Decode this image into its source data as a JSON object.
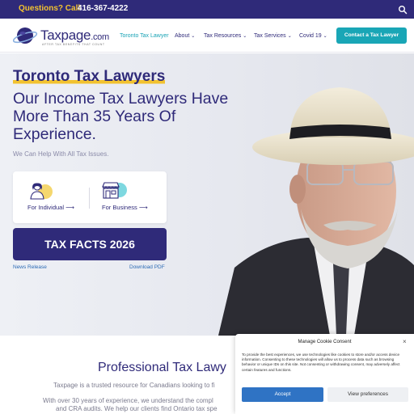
{
  "topbar": {
    "question": "Questions? Call",
    "phone": "416-367-4222"
  },
  "logo": {
    "word": "Taxpage",
    "domain": ".com",
    "tagline": "AFTER TAX BENEFITS THAT COUNT"
  },
  "nav": {
    "items": [
      {
        "label": "Toronto Tax Lawyer",
        "dropdown": false,
        "active": true
      },
      {
        "label": "About",
        "dropdown": true
      },
      {
        "label": "Tax Resources",
        "dropdown": true
      },
      {
        "label": "Tax Services",
        "dropdown": true
      },
      {
        "label": "Covid 19",
        "dropdown": true
      }
    ],
    "chevron": "⌄",
    "cta": "Contact a Tax Lawyer"
  },
  "hero": {
    "title": "Toronto Tax Lawyers",
    "subtitle": "Our Income Tax Lawyers Have More Than 35 Years Of Experience.",
    "help": "We Can Help With All Tax Issues.",
    "individual": "For Individual ⟶",
    "business": "For Business ⟶",
    "tax_facts": "TAX FACTS 2026",
    "news": "News Release",
    "download": "Download PDF"
  },
  "content": {
    "title": "Professional Tax Lawy",
    "para1": "Taxpage is a trusted resource for Canadians looking to fi",
    "para2": "With over 30 years of experience, we understand the compl",
    "para3": "and CRA audits. We help our clients find Ontario tax spe"
  },
  "cookie": {
    "title": "Manage Cookie Consent",
    "close": "×",
    "body": "To provide the best experiences, we use technologies like cookies to store and/or access device information. Consenting to these technologies will allow us to process data such as browsing behavior or unique IDs on this site. Not consenting or withdrawing consent, may adversely affect certain features and functions.",
    "accept": "Accept",
    "preferences": "View preferences"
  },
  "colors": {
    "brand_navy": "#2f2a79",
    "accent_yellow": "#f2c230",
    "accent_teal": "#19a6b6",
    "link_blue": "#2d6bb5"
  },
  "icons": [
    "search-icon",
    "person-icon",
    "storefront-icon"
  ]
}
